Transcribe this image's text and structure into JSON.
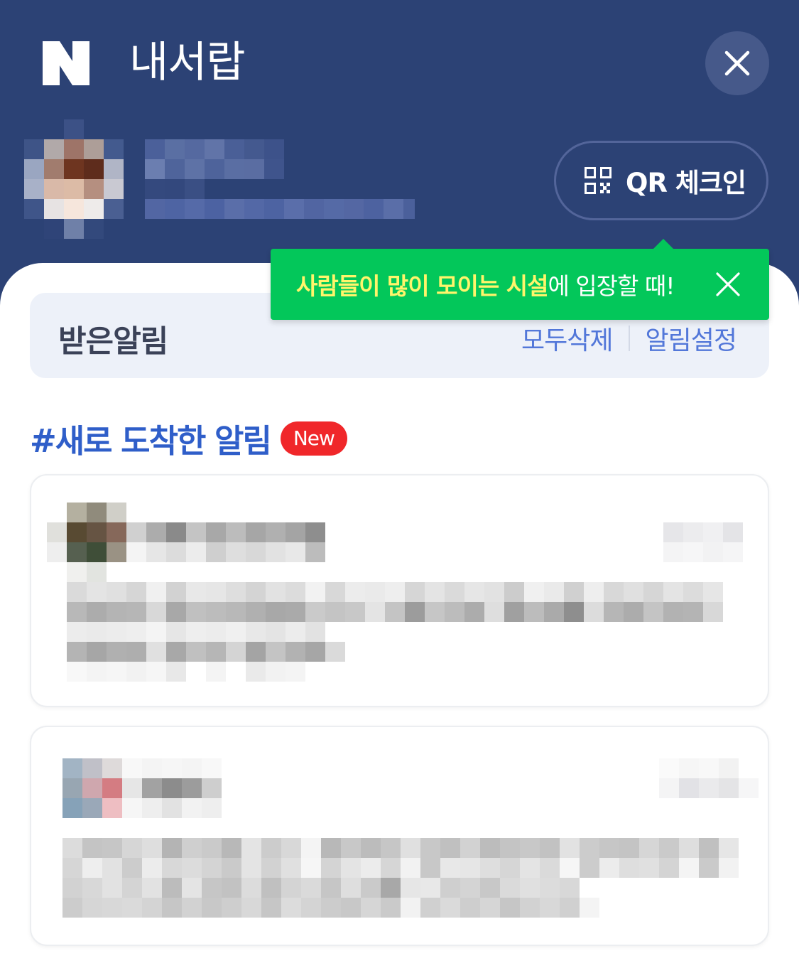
{
  "header": {
    "title": "내서랍",
    "logo": "N",
    "close_icon": "close-icon"
  },
  "profile": {
    "qr_button_label": "QR 체크인",
    "qr_icon": "qr-code-icon"
  },
  "tooltip": {
    "highlight": "사람들이 많이 모이는 시설",
    "rest": "에 입장할 때!",
    "close_icon": "close-icon"
  },
  "notice_bar": {
    "title": "받은알림",
    "delete_all": "모두삭제",
    "settings": "알림설정"
  },
  "section": {
    "heading": "#새로 도착한 알림",
    "badge": "New"
  },
  "colors": {
    "header_bg": "#2c4275",
    "tooltip_bg": "#03c75a",
    "tooltip_highlight": "#fff56b",
    "link": "#5277d9",
    "heading": "#2f5ec9",
    "badge": "#f0272a"
  }
}
